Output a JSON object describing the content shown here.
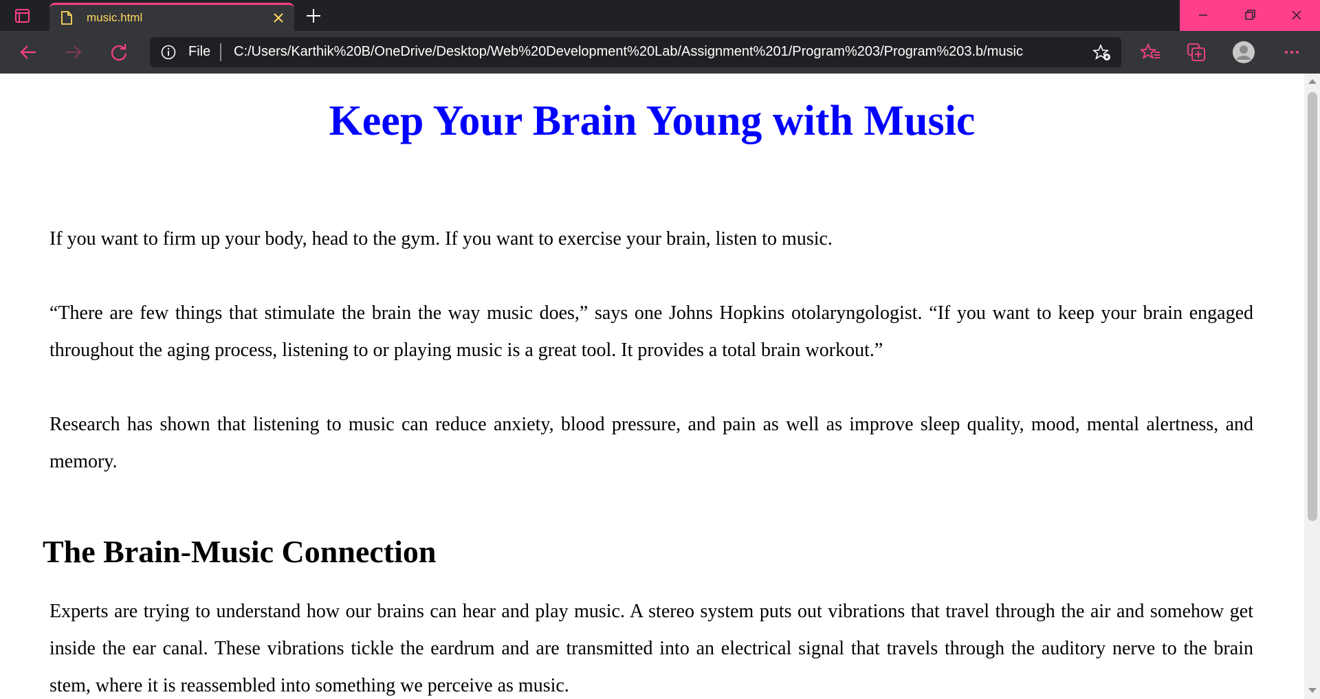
{
  "browser": {
    "tab": {
      "title": "music.html"
    },
    "address": {
      "scheme": "File",
      "url": "C:/Users/Karthik%20B/OneDrive/Desktop/Web%20Development%20Lab/Assignment%201/Program%203/Program%203.b/music.h..."
    },
    "accent_color": "#ff3f8a",
    "tab_title_color": "#ffd75e"
  },
  "page": {
    "title": "Keep Your Brain Young with Music",
    "title_color": "#0000ff",
    "paragraphs": [
      "If you want to firm up your body, head to the gym. If you want to exercise your brain, listen to music.",
      "“There are few things that stimulate the brain the way music does,” says one Johns Hopkins otolaryngologist. “If you want to keep your brain engaged throughout the aging process, listening to or playing music is a great tool. It provides a total brain workout.”",
      "Research has shown that listening to music can reduce anxiety, blood pressure, and pain as well as improve sleep quality, mood, mental alertness, and memory."
    ],
    "section": {
      "heading": "The Brain-Music Connection",
      "paragraph": "Experts are trying to understand how our brains can hear and play music. A stereo system puts out vibrations that travel through the air and somehow get inside the ear canal. These vibrations tickle the eardrum and are transmitted into an electrical signal that travels through the auditory nerve to the brain stem, where it is reassembled into something we perceive as music."
    }
  }
}
